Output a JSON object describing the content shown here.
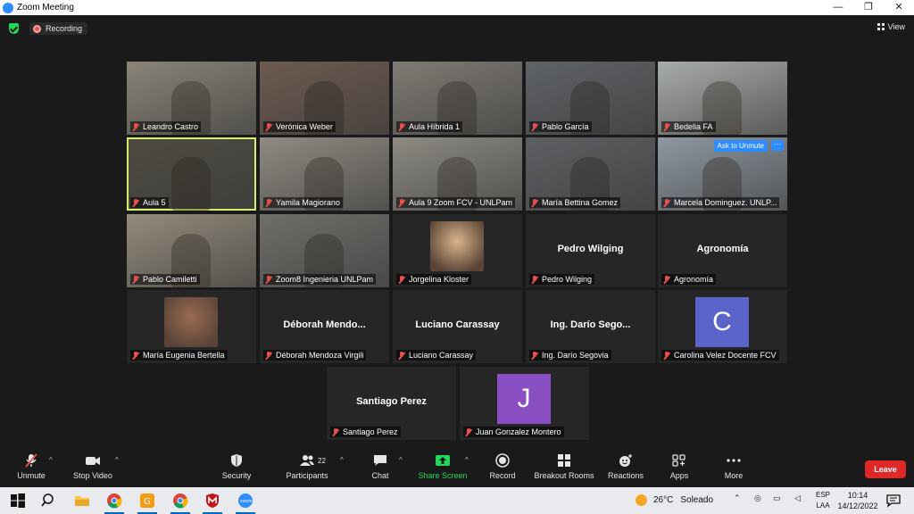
{
  "window": {
    "title": "Zoom Meeting"
  },
  "topbar": {
    "recording_label": "Recording",
    "view_label": "View"
  },
  "tiles": [
    {
      "name": "Leandro Castro",
      "bg": "#8a8478",
      "kind": "video"
    },
    {
      "name": "Verónica Weber",
      "bg": "#6d5a4f",
      "kind": "video"
    },
    {
      "name": "Aula Híbrida 1",
      "bg": "#7f7b74",
      "kind": "video"
    },
    {
      "name": "Pablo García",
      "bg": "#5f6266",
      "kind": "video"
    },
    {
      "name": "Bedelia FA",
      "bg": "#a8aca9",
      "kind": "video"
    },
    {
      "name": "Aula 5",
      "bg": "#4e4b42",
      "kind": "video"
    },
    {
      "name": "Yamila Magiorano",
      "bg": "#8f8a82",
      "kind": "video"
    },
    {
      "name": "Aula 9 Zoom FCV - UNLPam",
      "bg": "#8d8a83",
      "kind": "video"
    },
    {
      "name": "María Bettina Gomez",
      "bg": "#5d5f62",
      "kind": "video"
    },
    {
      "name": "Marcela Dominguez. UNLP...",
      "bg": "#8e98a0",
      "kind": "video",
      "ask_unmute": "Ask to Unmute",
      "more": "···"
    },
    {
      "name": "Pablo Camiletti",
      "bg": "#938b7c",
      "kind": "video"
    },
    {
      "name": "Zoom8 Ingenieria UNLPam",
      "bg": "#6f6e6a",
      "kind": "video"
    },
    {
      "name": "Jorgelina Kloster",
      "bg": "#262626",
      "kind": "photo",
      "photo": "#d9b48a"
    },
    {
      "name": "Pedro Wilging",
      "display": "Pedro Wilging",
      "kind": "name"
    },
    {
      "name": "Agronomía",
      "display": "Agronomía",
      "kind": "name"
    },
    {
      "name": "María Eugenia Bertella",
      "bg": "#262626",
      "kind": "photo",
      "photo": "#9a6a52"
    },
    {
      "name": "Déborah Mendoza Virgili",
      "display": "Déborah  Mendo...",
      "kind": "name"
    },
    {
      "name": "Luciano Carassay",
      "display": "Luciano Carassay",
      "kind": "name"
    },
    {
      "name": "Ing. Darío Segovia",
      "display": "Ing. Darío Sego...",
      "kind": "name"
    },
    {
      "name": "Carolina Velez Docente FCV",
      "kind": "letter",
      "letter": "C",
      "letter_bg": "#5b64c8"
    },
    {
      "name": "Santiago Perez",
      "display": "Santiago Perez",
      "kind": "name"
    },
    {
      "name": "Juan Gonzalez Montero",
      "kind": "letter",
      "letter": "J",
      "letter_bg": "#8a4fc2"
    }
  ],
  "toolbar": {
    "unmute": "Unmute",
    "stop_video": "Stop Video",
    "security": "Security",
    "participants": "Participants",
    "participants_count": "22",
    "chat": "Chat",
    "share_screen": "Share Screen",
    "record": "Record",
    "breakout_rooms": "Breakout Rooms",
    "reactions": "Reactions",
    "apps": "Apps",
    "more": "More",
    "leave": "Leave"
  },
  "taskbar": {
    "weather_temp": "26°C",
    "weather_text": "Soleado",
    "lang_top": "ESP",
    "lang_bottom": "LAA",
    "time": "10:14",
    "date": "14/12/2022"
  },
  "colors": {
    "accent": "#2D8CFF",
    "leave": "#e02828",
    "share": "#23d959",
    "muted": "#e8504f"
  }
}
